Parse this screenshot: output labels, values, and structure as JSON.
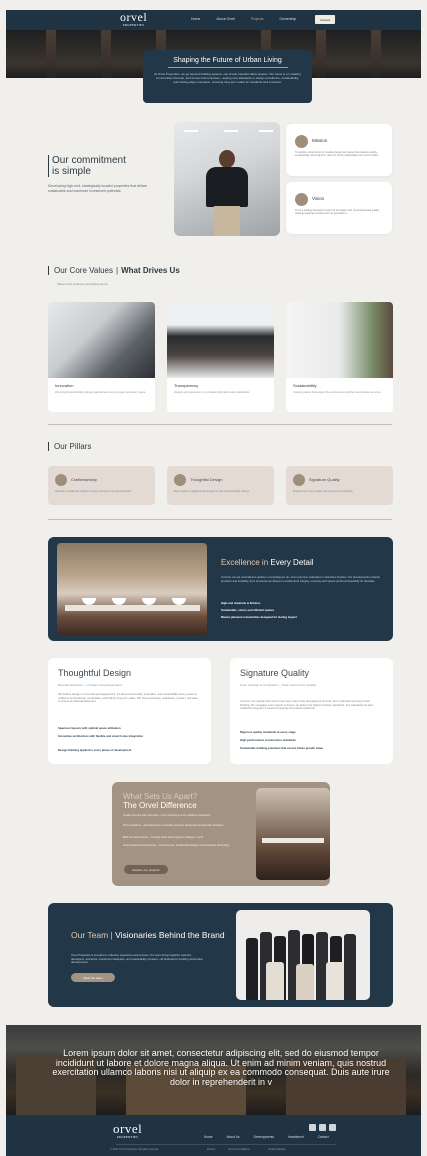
{
  "header": {
    "logo": "orvel",
    "logo_tag": "PROPERTIES",
    "nav": [
      "Home",
      "About Orvel",
      "Projects",
      "Ownership"
    ],
    "active_nav": "Projects",
    "contact_label": "Contact"
  },
  "hero": {
    "title": "Shaping the Future of Urban Living",
    "text": "At Orvel Properties, we go beyond building spaces—we create transformative spaces. Our focus is on creating communities that last, and homes that empower—setting new standards in design excellence, sustainability, and cutting-edge innovation, ensuring long-term value for residents and investors."
  },
  "commitment": {
    "title_1": "Our commitment",
    "title_2": "is simple",
    "text": "Developing high-end, strategically located properties that deliver sustainable and maximize investment potential.",
    "mission_title": "Mission",
    "mission_text": "To redefine urban living by creating design-led spaces that balance quality, sustainability, and long-term value for all our stakeholders and communities.",
    "vision_title": "Vision",
    "vision_text": "To be a leading developer known for innovation and uncompromising quality, shaping inspiring environments for generations."
  },
  "core_values": {
    "title_a": "Our Core Values",
    "title_b": "What Drives Us",
    "subtitle": "Values that underpin everything we do",
    "cards": [
      {
        "title": "Innovation",
        "text": "We bring forward-thinking design approaches to every project and every space."
      },
      {
        "title": "Transparency",
        "text": "Honesty and openness in our relationships with every stakeholder."
      },
      {
        "title": "Sustainability",
        "text": "Creating places that respect the environment and the communities we serve."
      }
    ]
  },
  "pillars": {
    "title": "Our Pillars",
    "cards": [
      {
        "title": "Craftsmanship",
        "text": "Attention to detail and mastery in every element of our developments."
      },
      {
        "title": "Thoughtful Design",
        "text": "Every space is designed with people in mind, functional and refined."
      },
      {
        "title": "Signature Quality",
        "text": "Excellence in every detail, from concept to completion."
      }
    ]
  },
  "excellence": {
    "title_a": "Excellence in",
    "title_b": "Every Detail",
    "text": "At Orvel, we are committed to quality in everything we do—from premium materials to meticulous finishes. Our developments embody precision and durability, from structural soundness to architectural integrity, ensuring each space performs beautifully for decades.",
    "list": [
      "High-end materials & finishes",
      "Sustainable, smart, and efficient spaces",
      "Master-planned communities designed for lasting impact"
    ]
  },
  "thoughtful": {
    "title": "Thoughtful Design",
    "subtitle": "Beyond Aesthetics — A Smart Living Experience",
    "text": "We believe design is more than just appearance. It's about functionality, innovation, and sustainability. Every space is crafted to be functional, comfortable, and built for long-term value. We focus on beauty, usefulness, comfort, and ease to ensure an ideal development.",
    "list": [
      "Spacious layouts with optimal space utilization",
      "Innovative architecture with flexible and smart home integration",
      "Design thinking applied to every phase of development"
    ]
  },
  "signature": {
    "title": "Signature Quality",
    "subtitle": "From Concept to Completion – Total Control Over Quality",
    "text": "At Orvel, we maintain full control over every step of the development process, from materials sourcing to final finishing. By managing every aspect in-house, we deliver the highest industry standards. Our standards are also verified for long-term investment security and market resilience.",
    "list": [
      "Rigorous quality standards at every stage",
      "High-performance construction standards",
      "Sustainable building practices that ensure future growth value"
    ]
  },
  "apart": {
    "title_a": "What Sets Us Apart?",
    "title_b": "The Orvel Difference",
    "list": [
      "Quality from the start approach – from planning to every detail to completion.",
      "Prime positions – developments in carefully selected, vibrant and sought-after locations.",
      "Built for real investors – creating value with long-term strategy in mind.",
      "Future-Ready Developments – Smart homes, sustainable designs and innovative technology."
    ],
    "button": "Explore our projects"
  },
  "team": {
    "title_a": "Our Team",
    "title_b": "Visionaries Behind the Brand",
    "text": "Orvel Properties is founded on collective experience and success. Our team brings together visionary developers, architects, investment strategists, and sustainability pioneers—all dedicated to building world-class developments.",
    "button": "Meet the team"
  },
  "banner": {
    "text": "Lorem ipsum dolor sit amet, consectetur adipiscing elit, sed do eiusmod tempor incididunt ut labore et dolore magna aliqua. Ut enim ad minim veniam, quis nostrud exercitation ullamco laboris nisi ut aliquip ex ea commodo consequat. Duis aute irure dolor in reprehenderit in v"
  },
  "footer": {
    "logo": "orvel",
    "logo_tag": "PROPERTIES",
    "nav": [
      "Home",
      "About Us",
      "Developments",
      "Investment",
      "Contact"
    ],
    "copyright": "© 2024 Orvel Properties. All rights reserved.",
    "legal": [
      "Privacy",
      "Terms & Conditions",
      "Cookie Settings"
    ],
    "social_icons": [
      "facebook-icon",
      "linkedin-icon",
      "instagram-icon"
    ]
  }
}
